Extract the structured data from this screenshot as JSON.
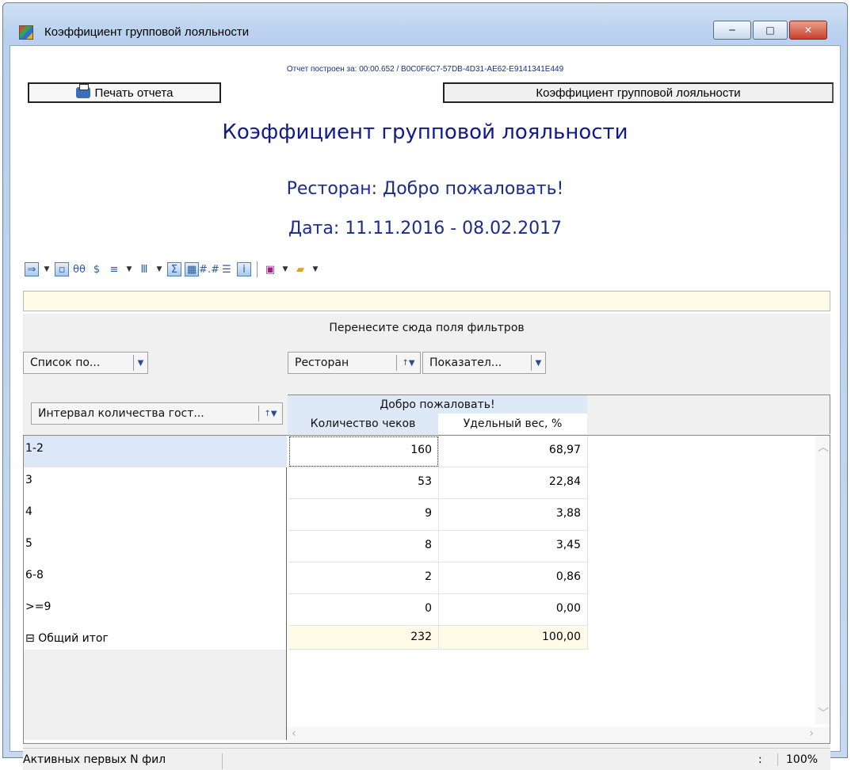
{
  "window": {
    "title": "Коэффициент групповой лояльности",
    "controls": {
      "minimize": "─",
      "maximize": "□",
      "close": "✕"
    }
  },
  "report": {
    "built_info": "Отчет построен за: 00:00.652 / B0C0F6C7-57DB-4D31-AE62-E9141341E449",
    "print_button": "Печать отчета",
    "report_button": "Коэффициент групповой лояльности",
    "title": "Коэффициент групповой лояльности",
    "restaurant": "Ресторан: Добро пожаловать!",
    "date": "Дата: 11.11.2016 - 08.02.2017"
  },
  "toolbar": {
    "icons": [
      "export-icon",
      "arrow-down-icon",
      "save-layout-icon",
      "hide-icon",
      "currency-icon",
      "columns-icon",
      "arrow-down-icon",
      "barcode-icon",
      "arrow-down-icon",
      "sum-icon",
      "heatmap-icon",
      "format-icon",
      "text-icon",
      "info-icon",
      "save-icon",
      "arrow-down-icon",
      "folder-icon",
      "arrow-down-icon"
    ]
  },
  "pivot": {
    "filter_hint": "Перенесите сюда поля фильтров",
    "field_list": "Список по...",
    "col_field_restaurant": "Ресторан",
    "col_field_indicators": "Показател...",
    "row_field": "Интервал количества гост...",
    "col_group": "Добро пожаловать!",
    "col_headers": [
      "Количество чеков",
      "Удельный вес, %"
    ],
    "rows": [
      {
        "label": "1-2",
        "checks": "160",
        "share": "68,97"
      },
      {
        "label": "3",
        "checks": "53",
        "share": "22,84"
      },
      {
        "label": "4",
        "checks": "9",
        "share": "3,88"
      },
      {
        "label": "5",
        "checks": "8",
        "share": "3,45"
      },
      {
        "label": "6-8",
        "checks": "2",
        "share": "0,86"
      },
      {
        "label": ">=9",
        "checks": "0",
        "share": "0,00"
      }
    ],
    "total": {
      "label": "Общий итог",
      "checks": "232",
      "share": "100,00",
      "toggle": "⊟"
    }
  },
  "status": {
    "left_text": "Активных первых N фил",
    "colon": ":",
    "zoom": "100%"
  }
}
